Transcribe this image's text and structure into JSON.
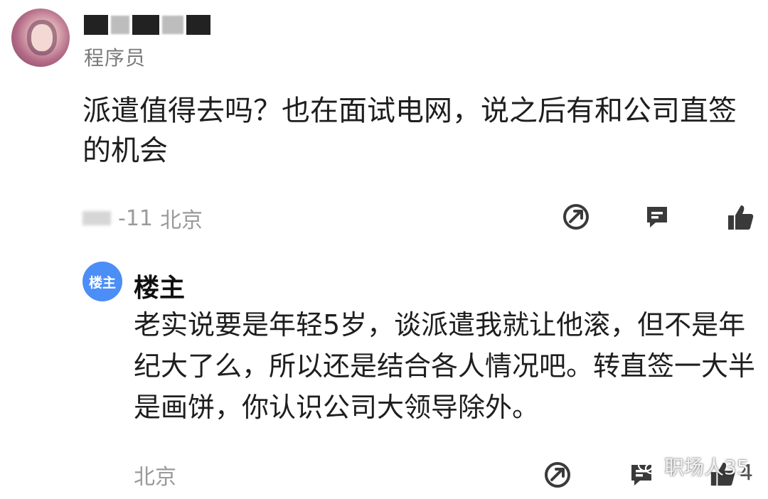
{
  "post": {
    "user_title": "程序员",
    "content": "派遣值得去吗？也在面试电网，说之后有和公司直签的机会",
    "date_suffix": "-11",
    "location": "北京"
  },
  "reply": {
    "badge_label": "楼主",
    "author": "楼主",
    "content": "老实说要是年轻5岁，谈派遣我就让他滚，但不是年纪大了么，所以还是结合各人情况吧。转直签一大半是画饼，你认识公司大领导除外。",
    "location": "北京",
    "like_count": "4"
  },
  "watermark": {
    "text": "职场人35"
  },
  "icons": {
    "share": "share-icon",
    "comment": "comment-icon",
    "like": "thumbs-up-icon"
  },
  "colors": {
    "badge": "#4b8ef5",
    "meta": "#9a9a9a",
    "icon": "#3a3a3a"
  }
}
